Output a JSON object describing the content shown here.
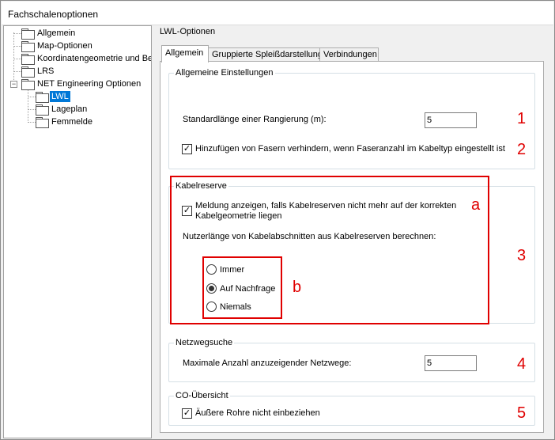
{
  "window": {
    "title": "Fachschalenoptionen"
  },
  "tree": {
    "items": [
      {
        "label": "Allgemein"
      },
      {
        "label": "Map-Optionen"
      },
      {
        "label": "Koordinatengeometrie und Bem"
      },
      {
        "label": "LRS"
      },
      {
        "label": "NET Engineering Optionen",
        "expander": "−"
      },
      {
        "label": "LWL",
        "selected": true
      },
      {
        "label": "Lageplan"
      },
      {
        "label": "Femmelde"
      }
    ]
  },
  "pane": {
    "title": "LWL-Optionen",
    "tabs": [
      {
        "label": "Allgemein",
        "active": true
      },
      {
        "label": "Gruppierte Spleißdarstellung"
      },
      {
        "label": "Verbindungen"
      }
    ]
  },
  "general": {
    "title": "Allgemeine Einstellungen",
    "std_length_label": "Standardlänge einer Rangierung (m):",
    "std_length_value": "5",
    "prevent_fibers_label": "Hinzufügen von Fasern verhindern, wenn Faseranzahl im Kabeltyp eingestellt ist",
    "prevent_fibers_checked": "✓"
  },
  "reserve": {
    "title": "Kabelreserve",
    "message_label_line1": "Meldung anzeigen, falls Kabelreserven nicht mehr auf der korrekten",
    "message_label_line2": "Kabelgeometrie liegen",
    "message_checked": "✓",
    "compute_label": "Nutzerlänge von Kabelabschnitten aus Kabelreserven berechnen:",
    "options": [
      {
        "label": "Immer"
      },
      {
        "label": "Auf Nachfrage",
        "selected": true
      },
      {
        "label": "Niemals"
      }
    ]
  },
  "netpath": {
    "title": "Netzwegsuche",
    "max_label": "Maximale Anzahl anzuzeigender Netzwege:",
    "max_value": "5"
  },
  "co": {
    "title": "CO-Übersicht",
    "outer_pipes_label": "Äußere Rohre nicht einbeziehen",
    "outer_pipes_checked": "✓"
  },
  "annotations": {
    "n1": "1",
    "n2": "2",
    "n3": "3",
    "n4": "4",
    "n5": "5",
    "a": "a",
    "b": "b",
    "color": "#e00000"
  }
}
